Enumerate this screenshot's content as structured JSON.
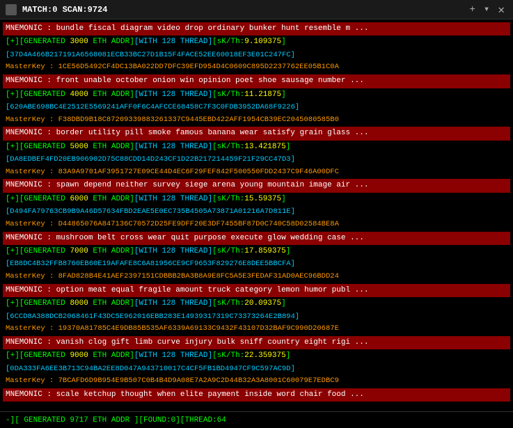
{
  "titleBar": {
    "title": "MATCH:0 SCAN:9724",
    "icon": "terminal-icon",
    "addBtn": "+",
    "dropBtn": "▾",
    "closeBtn": "✕"
  },
  "entries": [
    {
      "mnemonic": "MNEMONIC : bundle fiscal diagram video drop ordinary bunker hunt resemble m ...",
      "generated": "[+][GENERATED 3000 ETH ADDR][WITH 128 THREAD][sK/Th:9.109375]",
      "addr": "37D4A466B217191A6568081ECB33BC27D1B15F4FACE52EE60018EF3E01C247FC]",
      "masterkey": "MasterKey :  1CE56D5492CF4DC13BA022DD7DFC39EFD954D4C0609C895D2237762EE05B1C0A"
    },
    {
      "mnemonic": "MNEMONIC : front unable october onion win opinion poet shoe sausage number ...",
      "generated": "[+][GENERATED 4000 ETH ADDR][WITH 128 THREAD][sK/Th:11.21875]",
      "addr": "620ABE698BC4E2512E5569241AFF0F6C4AFCCE68458C7F3C0FDB3952DA68F9226]",
      "masterkey": "MasterKey :  F38DBD9B18C87209339883261337C9445EBD422AFF1954CB39EC2045080585B0"
    },
    {
      "mnemonic": "MNEMONIC : border utility pill smoke famous banana wear satisfy grain glass ...",
      "generated": "[+][GENERATED 5000 ETH ADDR][WITH 128 THREAD][sK/Th:13.421875]",
      "addr": "DA8EDBEF4FD20EB906902D75C88CDD14D243CF1D22B217214459F21F29CC47D3]",
      "masterkey": "MasterKey :  83A9A9701AF3951727E09CE44D4EC6F29FEF842F500550FDD2437C9F46A00DFC"
    },
    {
      "mnemonic": "MNEMONIC : spawn depend neither survey siege arena young mountain image air ...",
      "generated": "[+][GENERATED 6000 ETH ADDR][WITH 128 THREAD][sK/Th:15.59375]",
      "addr": "D494FA79763CB9B9A46D57634FBD2EAE5E0EC735B4505A73871A01216A7D811E]",
      "masterkey": "MasterKey :  D44865076A847136C70572D25FE9DFF20E3DF7455BF87D0C740C58D02584BE8A"
    },
    {
      "mnemonic": "MNEMONIC : mushroom belt cross wear quit purpose execute glow wedding case ...",
      "generated": "[+][GENERATED 7000 ETH ADDR][WITH 128 THREAD][sK/Th:17.859375]",
      "addr": "EB8DC4B32FFB8760EB60E19AFAFE8C6A81956CE9CF9653F829276E8DEE5BBCFA]",
      "masterkey": "MasterKey :  8FAD828B4E41AEF2397151CDBBB2BA3B8A9E8FC5A5E3FEDAF31AD0AEC96BDD24"
    },
    {
      "mnemonic": "MNEMONIC : option meat equal fragile amount truck category lemon humor publ ...",
      "generated": "[+][GENERATED 8000 ETH ADDR][WITH 128 THREAD][sK/Th:20.09375]",
      "addr": "6CCD8A388DCB2068461F43DC5E962016EBB283E14939317319C73373264E2B894]",
      "masterkey": "MasterKey :  19370A81785C4E9DB85B535AF6339A69133C9432F43107D32BAF9C990D20687E"
    },
    {
      "mnemonic": "MNEMONIC : vanish clog gift limb curve injury bulk sniff country eight rigi ...",
      "generated": "[+][GENERATED 9000 ETH ADDR][WITH 128 THREAD][sK/Th:22.359375]",
      "addr": "0DA333FA6EE3B713C94BA2EE8D047A943710017C4CF5FB1BD4947CF9C597AC9D]",
      "masterkey": "MasterKey :  7BCAFD6D9B954E9B507C0B4B4D9A08E7A2A9C2D44B32A3A8001C60079E7EDBC9"
    },
    {
      "mnemonic": "MNEMONIC : scale ketchup thought when elite payment inside word chair food ...",
      "generated": "",
      "addr": "",
      "masterkey": ""
    }
  ],
  "statusBar": {
    "text": "-][ GENERATED 9717 ETH ADDR ][FOUND:0][THREAD:64"
  }
}
